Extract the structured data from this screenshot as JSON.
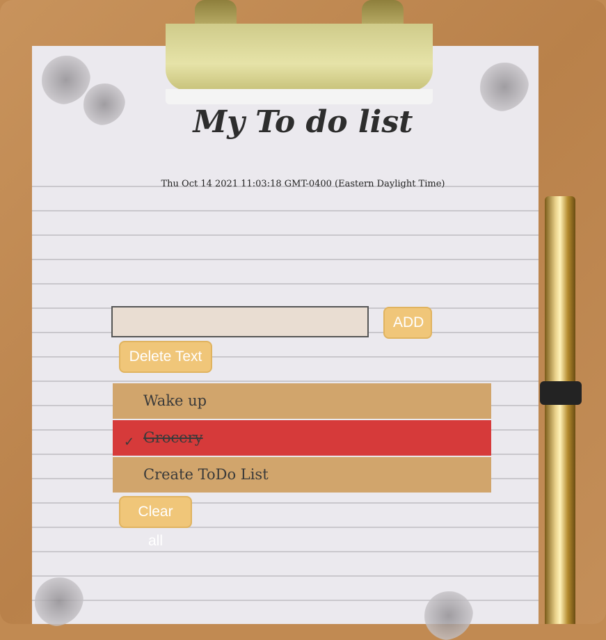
{
  "app": {
    "title": "My To do list",
    "datetime": "Thu Oct 14 2021 11:03:18 GMT-0400 (Eastern Daylight Time)"
  },
  "form": {
    "input_value": "",
    "add_label": "ADD",
    "delete_label": "Delete Text",
    "clear_label": "Clear all"
  },
  "tasks": [
    {
      "label": "Wake up",
      "done": false
    },
    {
      "label": "Grocery",
      "done": true,
      "check": "✓"
    },
    {
      "label": "Create ToDo List",
      "done": false
    }
  ],
  "colors": {
    "item_bg": "#d1a56c",
    "done_bg": "#d63a3a",
    "button_bg": "#f0c679"
  }
}
